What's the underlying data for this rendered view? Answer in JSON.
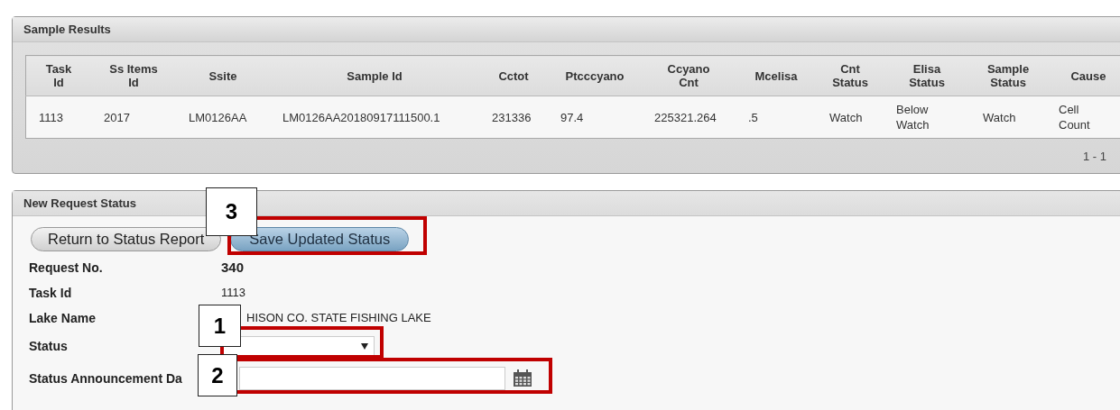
{
  "sample_results": {
    "title": "Sample Results",
    "columns": [
      "Task Id",
      "Ss Items Id",
      "Ssite",
      "Sample Id",
      "Cctot",
      "Ptcccyano",
      "Ccyano Cnt",
      "Mcelisa",
      "Cnt Status",
      "Elisa Status",
      "Sample Status",
      "Cause"
    ],
    "rows": [
      {
        "cells": [
          "1113",
          "2017",
          "LM0126AA",
          "LM0126AA20180917111500.1",
          "231336",
          "97.4",
          "225321.264",
          ".5",
          "Watch",
          "Below Watch",
          "Watch",
          "Cell Count"
        ]
      }
    ],
    "pager": "1 - 1"
  },
  "new_request_status": {
    "title": "New Request Status",
    "buttons": [
      {
        "label": "Return to Status Report",
        "kind": "default"
      },
      {
        "label": "Save Updated Status",
        "kind": "primary"
      }
    ],
    "fields": [
      {
        "label": "Request No.",
        "value": "340",
        "kind": "strong"
      },
      {
        "label": "Task Id",
        "value": "1113",
        "kind": "text"
      },
      {
        "label": "Lake Name",
        "value": "HISON CO. STATE FISHING LAKE",
        "kind": "text"
      },
      {
        "label": "Status",
        "kind": "select"
      },
      {
        "label": "Status Announcement Da",
        "kind": "date"
      }
    ]
  },
  "annotations": [
    {
      "label": "3"
    },
    {
      "label": "1"
    },
    {
      "label": "2"
    }
  ]
}
